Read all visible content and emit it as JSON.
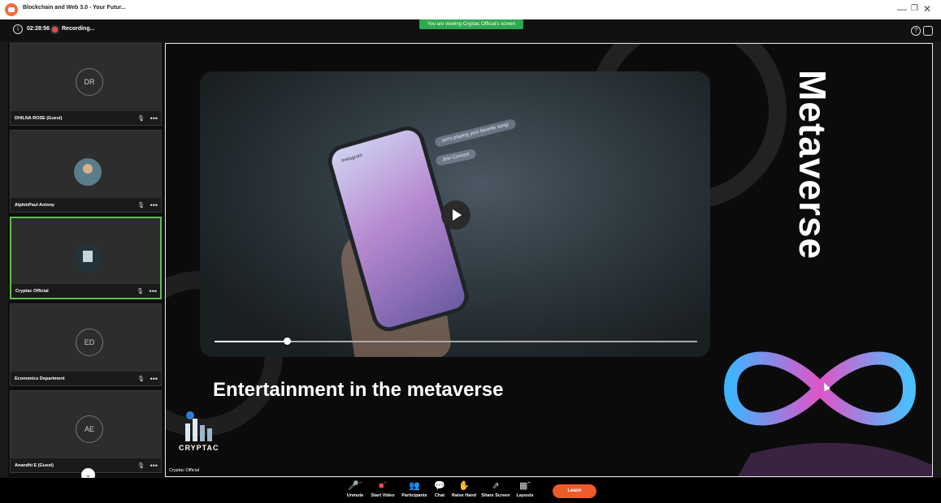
{
  "window": {
    "title": "Blockchain and Web 3.0 - Your Futur..."
  },
  "topbar": {
    "timer": "02:28:56",
    "recording_label": "Recording...",
    "viewing_banner": "You are viewing Cryptac Official's screen"
  },
  "participants": [
    {
      "name": "DHILNA ROSE (Guest)",
      "initials": "DR",
      "kind": "initials",
      "active": false
    },
    {
      "name": "AlphinPaul Antony",
      "initials": "",
      "kind": "photo",
      "active": false
    },
    {
      "name": "Cryptac Official",
      "initials": "",
      "kind": "logo",
      "active": true
    },
    {
      "name": "Economics Department",
      "initials": "ED",
      "kind": "initials",
      "active": false
    },
    {
      "name": "Anandhi E (Guest)",
      "initials": "AE",
      "kind": "initials",
      "active": false
    }
  ],
  "share": {
    "heading": "Entertainment in the metaverse",
    "vertical_word": "Metaverse",
    "brand": "CRYPTAC",
    "presenter_caption": "Cryptac Official",
    "video": {
      "progress_percent": 15,
      "bubble_song": "Jon's playing your favorite song!",
      "bubble_join": "Join Concert",
      "app_label": "Instagram"
    }
  },
  "toolbar": {
    "buttons": [
      {
        "label": "Unmute",
        "icon": "mic-muted-icon"
      },
      {
        "label": "Start Video",
        "icon": "video-off-icon"
      },
      {
        "label": "Participants",
        "icon": "participants-icon"
      },
      {
        "label": "Chat",
        "icon": "chat-icon"
      },
      {
        "label": "Raise Hand",
        "icon": "hand-icon"
      },
      {
        "label": "Share Screen",
        "icon": "share-screen-icon"
      },
      {
        "label": "Layouts",
        "icon": "layout-icon"
      }
    ],
    "leave_label": "Leave"
  },
  "colors": {
    "accent_green": "#2fa84f",
    "active_border": "#5fbf4a",
    "leave": "#ec5b2a",
    "record": "#e34c4c"
  }
}
